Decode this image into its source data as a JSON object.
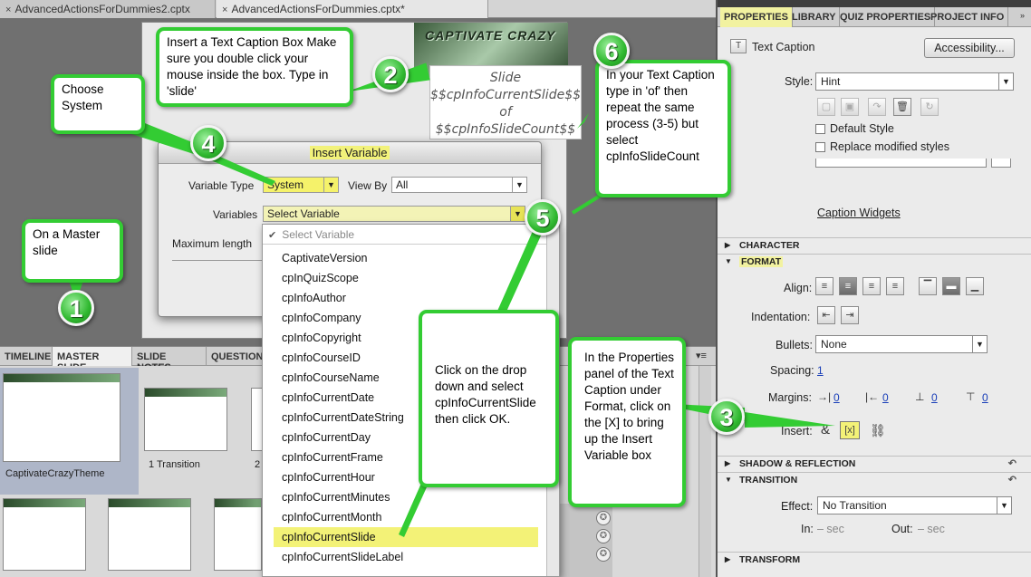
{
  "doc_tabs": [
    {
      "label": "AdvancedActionsForDummies2.cptx",
      "close": "×"
    },
    {
      "label": "AdvancedActionsForDummies.cptx*",
      "close": "×"
    }
  ],
  "slide": {
    "banner_text": "CAPTIVATE CRAZY",
    "caption_lines": [
      "Slide",
      "$$cpInfoCurrentSlide$$",
      "of",
      "$$cpInfoSlideCount$$"
    ]
  },
  "dialog": {
    "title": "Insert Variable",
    "variable_type_label": "Variable Type",
    "variable_type_value": "System",
    "view_by_label": "View By",
    "view_by_value": "All",
    "variables_label": "Variables",
    "variables_value": "Select Variable",
    "max_length_label": "Maximum length"
  },
  "variable_list": {
    "header": "Select Variable",
    "check": "✔",
    "items": [
      "CaptivateVersion",
      "cpInQuizScope",
      "cpInfoAuthor",
      "cpInfoCompany",
      "cpInfoCopyright",
      "cpInfoCourseID",
      "cpInfoCourseName",
      "cpInfoCurrentDate",
      "cpInfoCurrentDateString",
      "cpInfoCurrentDay",
      "cpInfoCurrentFrame",
      "cpInfoCurrentHour",
      "cpInfoCurrentMinutes",
      "cpInfoCurrentMonth",
      "cpInfoCurrentSlide",
      "cpInfoCurrentSlideLabel"
    ],
    "selected": "cpInfoCurrentSlide"
  },
  "bottom_tabs": [
    "TIMELINE",
    "MASTER SLIDE",
    "SLIDE NOTES",
    "QUESTION"
  ],
  "bottom_active_tab": "MASTER SLIDE",
  "filmstrip": {
    "thumbs": [
      {
        "label": "CaptivateCrazyTheme"
      },
      {
        "label": "1 Transition"
      },
      {
        "label": "2"
      }
    ]
  },
  "properties": {
    "tabs": [
      "PROPERTIES",
      "LIBRARY",
      "QUIZ PROPERTIES",
      "PROJECT INFO"
    ],
    "active_tab": "PROPERTIES",
    "object_type": "Text Caption",
    "accessibility_button": "Accessibility...",
    "style_label": "Style:",
    "style_value": "Hint",
    "default_style_label": "Default Style",
    "replace_styles_label": "Replace modified styles",
    "caption_widgets_link": "Caption Widgets",
    "sections": {
      "character": "CHARACTER",
      "format": "FORMAT",
      "shadow": "SHADOW & REFLECTION",
      "transition": "TRANSITION",
      "transform": "TRANSFORM"
    },
    "align_label": "Align:",
    "indentation_label": "Indentation:",
    "bullets_label": "Bullets:",
    "bullets_value": "None",
    "spacing_label": "Spacing:",
    "spacing_value": "1",
    "margins_label": "Margins:",
    "margin_values": [
      "0",
      "0",
      "0",
      "0"
    ],
    "insert_label": "Insert:",
    "insert_symbol": "&",
    "insert_variable": "[x]",
    "effect_label": "Effect:",
    "effect_value": "No Transition",
    "in_label": "In:",
    "in_value": "– sec",
    "out_label": "Out:",
    "out_value": "– sec"
  },
  "callouts": {
    "c1": "On a Master slide",
    "c2": "Insert a Text Caption Box Make sure you double click your mouse inside the box. Type in 'slide'",
    "c3": "In the Properties panel of the Text Caption under Format, click on the [X] to bring up the Insert Variable box",
    "c4": "Choose System",
    "c5": "Click on the drop down and select cpInfoCurrentSlide then click OK.",
    "c6": "In your Text Caption type in 'of' then repeat the same process (3-5) but select cpInfoSlideCount"
  },
  "bubbles": [
    "1",
    "2",
    "3",
    "4",
    "5",
    "6"
  ],
  "colors": {
    "callout_border": "#33cc33",
    "highlight": "#f3f277",
    "link": "#1a3fb8"
  }
}
